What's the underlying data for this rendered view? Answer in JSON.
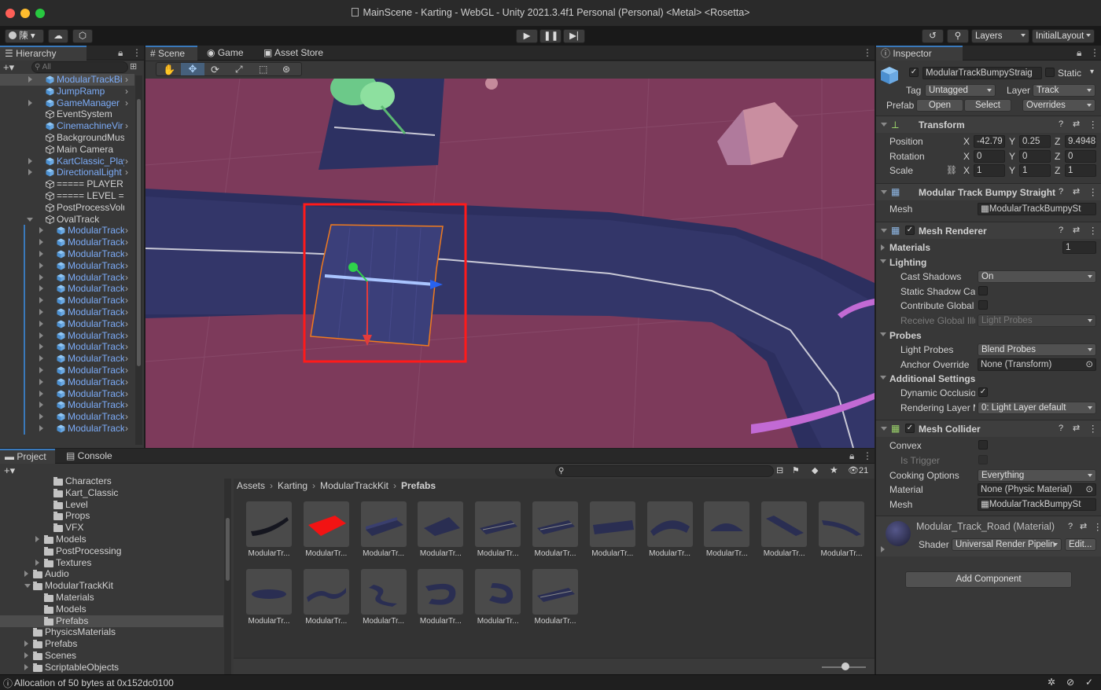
{
  "window": {
    "title": "MainScene - Karting - WebGL - Unity 2021.3.4f1 Personal (Personal) <Metal> <Rosetta>"
  },
  "toolbar": {
    "account_label": "陳",
    "layers_label": "Layers",
    "layout_label": "InitialLayout"
  },
  "hierarchy": {
    "tab": "Hierarchy",
    "search_placeholder": "All",
    "items": [
      {
        "label": "ModularTrackBi",
        "depth": 1,
        "prefab": true,
        "arrow": "right",
        "selected": true
      },
      {
        "label": "JumpRamp",
        "depth": 1,
        "prefab": true,
        "arrow": "none"
      },
      {
        "label": "GameManager",
        "depth": 1,
        "prefab": true,
        "arrow": "right"
      },
      {
        "label": "EventSystem",
        "depth": 1,
        "prefab": false,
        "arrow": "none"
      },
      {
        "label": "CinemachineVir",
        "depth": 1,
        "prefab": true,
        "arrow": "none"
      },
      {
        "label": "BackgroundMusic",
        "depth": 1,
        "prefab": false,
        "arrow": "none"
      },
      {
        "label": "Main Camera",
        "depth": 1,
        "prefab": false,
        "arrow": "none"
      },
      {
        "label": "KartClassic_Play",
        "depth": 1,
        "prefab": true,
        "arrow": "right"
      },
      {
        "label": "DirectionalLight",
        "depth": 1,
        "prefab": true,
        "arrow": "right"
      },
      {
        "label": "===== PLAYER ==",
        "depth": 1,
        "prefab": false,
        "arrow": "none"
      },
      {
        "label": "===== LEVEL ===",
        "depth": 1,
        "prefab": false,
        "arrow": "none"
      },
      {
        "label": "PostProcessVolum",
        "depth": 1,
        "prefab": false,
        "arrow": "none"
      },
      {
        "label": "OvalTrack",
        "depth": 1,
        "prefab": false,
        "arrow": "down"
      },
      {
        "label": "ModularTrack",
        "depth": 2,
        "prefab": true,
        "arrow": "right"
      },
      {
        "label": "ModularTrack",
        "depth": 2,
        "prefab": true,
        "arrow": "right"
      },
      {
        "label": "ModularTrack",
        "depth": 2,
        "prefab": true,
        "arrow": "right"
      },
      {
        "label": "ModularTrack",
        "depth": 2,
        "prefab": true,
        "arrow": "right"
      },
      {
        "label": "ModularTrack",
        "depth": 2,
        "prefab": true,
        "arrow": "right"
      },
      {
        "label": "ModularTrack",
        "depth": 2,
        "prefab": true,
        "arrow": "right"
      },
      {
        "label": "ModularTrack",
        "depth": 2,
        "prefab": true,
        "arrow": "right"
      },
      {
        "label": "ModularTrack",
        "depth": 2,
        "prefab": true,
        "arrow": "right"
      },
      {
        "label": "ModularTrack",
        "depth": 2,
        "prefab": true,
        "arrow": "right"
      },
      {
        "label": "ModularTrack",
        "depth": 2,
        "prefab": true,
        "arrow": "right"
      },
      {
        "label": "ModularTrack",
        "depth": 2,
        "prefab": true,
        "arrow": "right"
      },
      {
        "label": "ModularTrack",
        "depth": 2,
        "prefab": true,
        "arrow": "right"
      },
      {
        "label": "ModularTrack",
        "depth": 2,
        "prefab": true,
        "arrow": "right"
      },
      {
        "label": "ModularTrack",
        "depth": 2,
        "prefab": true,
        "arrow": "right"
      },
      {
        "label": "ModularTrack",
        "depth": 2,
        "prefab": true,
        "arrow": "right"
      },
      {
        "label": "ModularTrack",
        "depth": 2,
        "prefab": true,
        "arrow": "right"
      },
      {
        "label": "ModularTrack",
        "depth": 2,
        "prefab": true,
        "arrow": "right"
      },
      {
        "label": "ModularTrack",
        "depth": 2,
        "prefab": true,
        "arrow": "right"
      }
    ]
  },
  "scene": {
    "tabs": [
      "Scene",
      "Game",
      "Asset Store"
    ],
    "tools": [
      "hand-tool-icon",
      "move-tool-icon",
      "rotate-tool-icon",
      "scale-tool-icon",
      "rect-tool-icon",
      "transform-tool-icon"
    ]
  },
  "inspector": {
    "tab": "Inspector",
    "object_name": "ModularTrackBumpyStraig",
    "static_label": "Static",
    "tag_label": "Tag",
    "tag_value": "Untagged",
    "layer_label": "Layer",
    "layer_value": "Track",
    "prefab_label": "Prefab",
    "open_label": "Open",
    "select_label": "Select",
    "overrides_label": "Overrides",
    "transform": {
      "title": "Transform",
      "position_label": "Position",
      "pos": [
        "-42.79",
        "0.25",
        "9.4948"
      ],
      "rotation_label": "Rotation",
      "rot": [
        "0",
        "0",
        "0"
      ],
      "scale_label": "Scale",
      "scl": [
        "1",
        "1",
        "1"
      ],
      "axes": [
        "X",
        "Y",
        "Z"
      ]
    },
    "mesh_filter": {
      "title": "Modular Track Bumpy Straight",
      "mesh_label": "Mesh",
      "mesh_value": "ModularTrackBumpySt"
    },
    "mesh_renderer": {
      "title": "Mesh Renderer",
      "materials_label": "Materials",
      "materials_count": "1",
      "lighting_label": "Lighting",
      "cast_shadows_label": "Cast Shadows",
      "cast_shadows_value": "On",
      "static_shadow_label": "Static Shadow Cas",
      "contribute_gi_label": "Contribute Global I",
      "receive_gi_label": "Receive Global Illu",
      "receive_gi_value": "Light Probes",
      "probes_label": "Probes",
      "light_probes_label": "Light Probes",
      "light_probes_value": "Blend Probes",
      "anchor_label": "Anchor Override",
      "anchor_value": "None (Transform)",
      "additional_label": "Additional Settings",
      "dynamic_occlusion_label": "Dynamic Occlusion",
      "rendering_layer_label": "Rendering Layer M",
      "rendering_layer_value": "0: Light Layer default"
    },
    "mesh_collider": {
      "title": "Mesh Collider",
      "convex_label": "Convex",
      "trigger_label": "Is Trigger",
      "cooking_label": "Cooking Options",
      "cooking_value": "Everything",
      "material_label": "Material",
      "material_value": "None (Physic Material)",
      "mesh_label": "Mesh",
      "mesh_value": "ModularTrackBumpySt"
    },
    "material": {
      "title": "Modular_Track_Road (Material)",
      "shader_label": "Shader",
      "shader_value": "Universal Render Pipelin",
      "edit_label": "Edit..."
    },
    "add_component_label": "Add Component"
  },
  "project": {
    "tabs": [
      "Project",
      "Console"
    ],
    "hidden_count": "21",
    "breadcrumb": [
      "Assets",
      "Karting",
      "ModularTrackKit",
      "Prefabs"
    ],
    "tree": [
      {
        "label": "Characters",
        "depth": 3,
        "arrow": "none"
      },
      {
        "label": "Kart_Classic",
        "depth": 3,
        "arrow": "none"
      },
      {
        "label": "Level",
        "depth": 3,
        "arrow": "none"
      },
      {
        "label": "Props",
        "depth": 3,
        "arrow": "none"
      },
      {
        "label": "VFX",
        "depth": 3,
        "arrow": "none"
      },
      {
        "label": "Models",
        "depth": 2,
        "arrow": "right"
      },
      {
        "label": "PostProcessing",
        "depth": 2,
        "arrow": "none"
      },
      {
        "label": "Textures",
        "depth": 2,
        "arrow": "right"
      },
      {
        "label": "Audio",
        "depth": 1,
        "arrow": "right"
      },
      {
        "label": "ModularTrackKit",
        "depth": 1,
        "arrow": "down"
      },
      {
        "label": "Materials",
        "depth": 2,
        "arrow": "none"
      },
      {
        "label": "Models",
        "depth": 2,
        "arrow": "none"
      },
      {
        "label": "Prefabs",
        "depth": 2,
        "arrow": "none",
        "selected": true
      },
      {
        "label": "PhysicsMaterials",
        "depth": 1,
        "arrow": "none"
      },
      {
        "label": "Prefabs",
        "depth": 1,
        "arrow": "right"
      },
      {
        "label": "Scenes",
        "depth": 1,
        "arrow": "right"
      },
      {
        "label": "ScriptableObjects",
        "depth": 1,
        "arrow": "right"
      }
    ],
    "assets": [
      {
        "label": "ModularTr...",
        "shape": "curve-left"
      },
      {
        "label": "ModularTr...",
        "shape": "red"
      },
      {
        "label": "ModularTr...",
        "shape": "ramp"
      },
      {
        "label": "ModularTr...",
        "shape": "ramp2"
      },
      {
        "label": "ModularTr...",
        "shape": "flat"
      },
      {
        "label": "ModularTr...",
        "shape": "flat"
      },
      {
        "label": "ModularTr...",
        "shape": "wide"
      },
      {
        "label": "ModularTr...",
        "shape": "fan"
      },
      {
        "label": "ModularTr...",
        "shape": "dome"
      },
      {
        "label": "ModularTr...",
        "shape": "diag"
      },
      {
        "label": "ModularTr...",
        "shape": "curve-right"
      },
      {
        "label": "ModularTr...",
        "shape": "small"
      },
      {
        "label": "ModularTr...",
        "shape": "wave"
      },
      {
        "label": "ModularTr...",
        "shape": "s"
      },
      {
        "label": "ModularTr...",
        "shape": "u"
      },
      {
        "label": "ModularTr...",
        "shape": "hook"
      },
      {
        "label": "ModularTr...",
        "shape": "flat"
      }
    ]
  },
  "status": {
    "message": "Allocation of 50 bytes at 0x152dc0100"
  }
}
